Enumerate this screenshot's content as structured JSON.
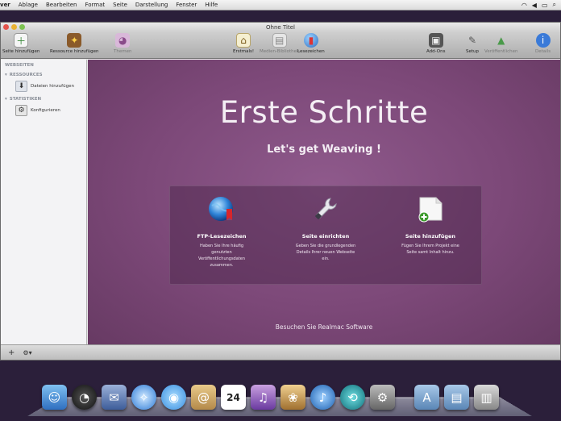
{
  "menubar": {
    "app": "ver",
    "items": [
      "Ablage",
      "Bearbeiten",
      "Format",
      "Seite",
      "Darstellung",
      "Fenster",
      "Hilfe"
    ]
  },
  "window": {
    "title": "Ohne Titel"
  },
  "toolbar": {
    "add_page": "Seite hinzufügen",
    "add_resource": "Ressource hinzufügen",
    "themes": "Themen",
    "home": "Erstmals!",
    "media_library": "Medien-Bibliothek",
    "bookmarks": "Lesezeichen",
    "add_on": "Add-Ons",
    "setup": "Setup",
    "publish": "Veröffentlichen",
    "details": "Details"
  },
  "sidebar": {
    "header": "WEBSEITEN",
    "resources_group": "RESSOURCES",
    "resources_item": "Dateien hinzufügen",
    "statistics_group": "STATISTIKEN",
    "statistics_item": "Konfigurieren"
  },
  "main": {
    "title": "Erste Schritte",
    "subtitle": "Let's get Weaving !",
    "cards": [
      {
        "title": "FTP-Lesezeichen",
        "desc": "Haben Sie Ihre häufig genutzten Veröffentlichungsdaten zusammen."
      },
      {
        "title": "Seite einrichten",
        "desc": "Geben Sie die grundlegenden Details Ihrer neuen Webseite ein."
      },
      {
        "title": "Seite hinzufügen",
        "desc": "Fügen Sie Ihrem Projekt eine Seite samt Inhalt hinzu."
      }
    ],
    "visit_link": "Besuchen Sie Realmac Software"
  },
  "bottombar": {
    "add": "+",
    "settings": "⚙▾"
  },
  "colors": {
    "content_bg": "#7c4878",
    "panel_bg": "#4a2547"
  }
}
